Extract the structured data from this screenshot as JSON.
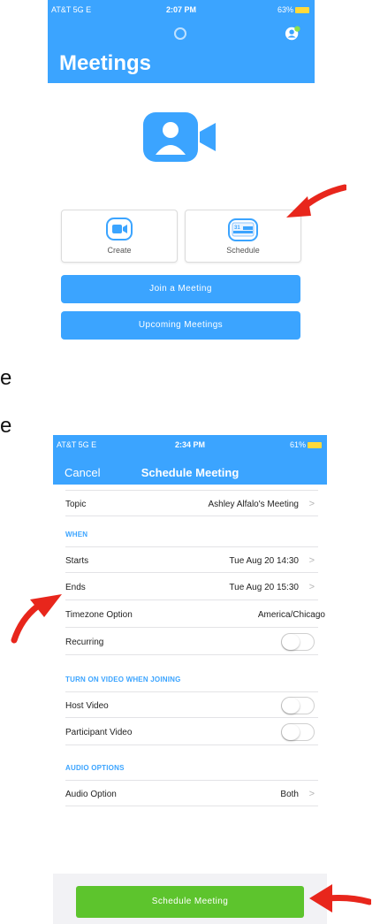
{
  "screen1": {
    "status": {
      "carrier": "AT&T  5G E",
      "time": "2:07 PM",
      "battery": "63%"
    },
    "title": "Meetings",
    "cards": {
      "create": "Create",
      "schedule": "Schedule",
      "calendar_day": "31"
    },
    "buttons": {
      "join": "Join a Meeting",
      "upcoming": "Upcoming Meetings"
    }
  },
  "partial_text": {
    "line1": "e",
    "line2": "e"
  },
  "screen2": {
    "status": {
      "carrier": "AT&T  5G E",
      "time": "2:34 PM",
      "battery": "61%"
    },
    "header": {
      "cancel": "Cancel",
      "title": "Schedule Meeting"
    },
    "topic": {
      "label": "Topic",
      "value": "Ashley Alfalo's Meeting"
    },
    "when_section": "WHEN",
    "starts": {
      "label": "Starts",
      "value": "Tue Aug 20 14:30"
    },
    "ends": {
      "label": "Ends",
      "value": "Tue Aug 20 15:30"
    },
    "timezone": {
      "label": "Timezone Option",
      "value": "America/Chicago"
    },
    "recurring": {
      "label": "Recurring",
      "on": false
    },
    "video_section": "TURN ON VIDEO WHEN JOINING",
    "host_video": {
      "label": "Host Video",
      "on": false
    },
    "participant_video": {
      "label": "Participant Video",
      "on": false
    },
    "audio_section": "AUDIO OPTIONS",
    "audio_option": {
      "label": "Audio Option",
      "value": "Both"
    },
    "schedule_button": "Schedule Meeting"
  },
  "colors": {
    "brand_blue": "#3ba4ff",
    "schedule_green": "#5dc42d",
    "arrow_red": "#e8261c"
  },
  "icons": [
    "search-icon",
    "profile-icon",
    "zoom-logo-icon",
    "video-camera-icon",
    "calendar-icon",
    "chevron-right-icon",
    "red-arrow-icon"
  ]
}
